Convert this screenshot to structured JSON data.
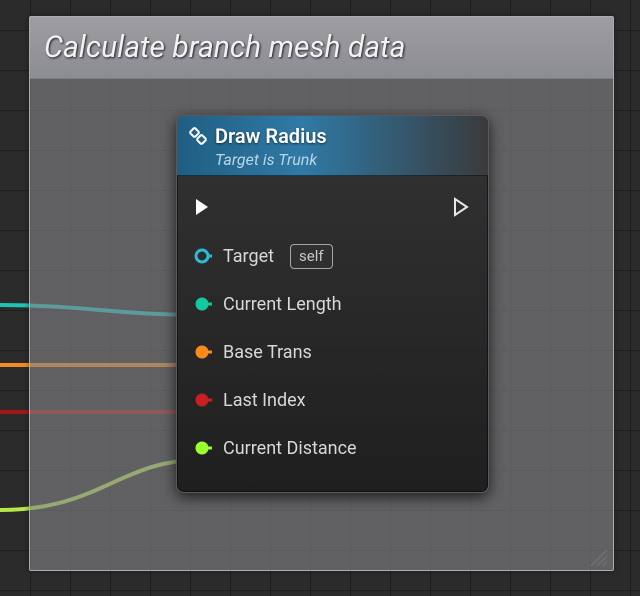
{
  "group": {
    "title": "Calculate branch mesh data"
  },
  "node": {
    "title": "Draw Radius",
    "subtitle": "Target is Trunk",
    "target_self_label": "self",
    "pins": {
      "target": "Target",
      "current_length": "Current Length",
      "base_trans": "Base Trans",
      "last_index": "Last Index",
      "current_distance": "Current Distance"
    },
    "pin_colors": {
      "target": "#2fb9d6",
      "current_length": "#14c8a0",
      "base_trans": "#ff8a1c",
      "last_index": "#c82020",
      "current_distance": "#9cff2e"
    }
  },
  "wire_colors": {
    "current_length": "#1fc2b5",
    "base_trans": "#f58b1e",
    "last_index": "#a11717",
    "current_distance": "#b7e84a"
  }
}
